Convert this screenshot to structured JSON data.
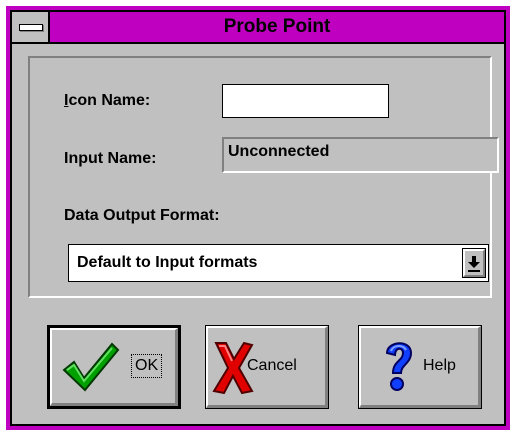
{
  "window": {
    "title": "Probe Point",
    "frame_color": "#c000c0",
    "face_color": "#c0c0c0"
  },
  "form": {
    "icon_name_label_prefix": "I",
    "icon_name_label_rest": "con Name:",
    "icon_name_value": "",
    "input_name_label": "Input Name:",
    "input_name_value": "Unconnected",
    "data_output_format_label": "Data Output Format:",
    "data_output_format_value": "Default to Input formats"
  },
  "buttons": {
    "ok_label": "OK",
    "ok_icon": "green-checkmark-icon",
    "cancel_label": "Cancel",
    "cancel_icon": "red-x-icon",
    "help_label": "Help",
    "help_icon": "blue-question-mark-icon"
  },
  "icons": {
    "system_menu": "system-menu-icon",
    "dropdown": "dropdown-arrow-icon"
  }
}
